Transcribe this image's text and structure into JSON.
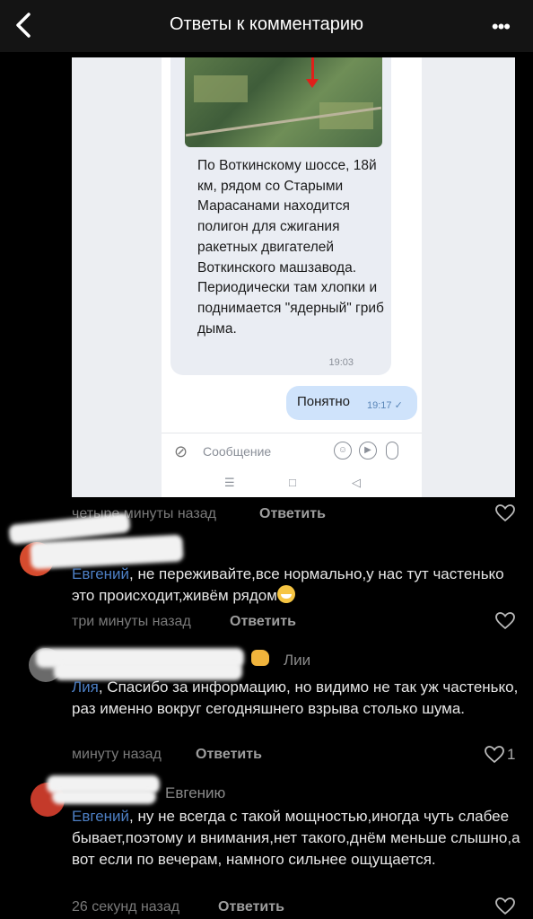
{
  "header": {
    "title": "Ответы к комментарию",
    "back": "back-chevron-icon",
    "more": "•••"
  },
  "screenshot": {
    "message": "По Воткинскому шоссе, 18й км, рядом со Старыми Марасанами находится полигон для сжигания ракетных двигателей Воткинского машзавода. Периодически там хлопки и поднимается \"ядерный\" гриб дыма.",
    "time": "19:03",
    "reply_text": "Понятно",
    "reply_time": "19:17 ✓",
    "compose_placeholder": "Сообщение",
    "nav": [
      "☰",
      "□",
      "◁"
    ]
  },
  "comments": [
    {
      "time": "четыре минуты назад",
      "reply": "Ответить"
    },
    {
      "mention": "Евгений",
      "text": ", не переживайте,все нормально,у нас тут частенько это происходит,живём рядом",
      "time": "три минуты назад",
      "reply": "Ответить"
    },
    {
      "addressee": "Лии",
      "mention": "Лия",
      "text": ", Спасибо за информацию, но видимо не так уж частенько, раз именно вокруг сегодняшнего взрыва столько шума.",
      "time": "минуту назад",
      "reply": "Ответить",
      "likes": "1"
    },
    {
      "addressee": "Евгению",
      "mention": "Евгений",
      "text": ", ну не всегда с такой мощностью,иногда чуть слабее бывает,поэтому и внимания,нет такого,днём меньше слышно,а вот если по вечерам, намного сильнее ощущается.",
      "time": "26 секунд назад",
      "reply": "Ответить"
    }
  ],
  "colors": {
    "background": "#000000",
    "header": "#141414",
    "mention": "#4d7fc4",
    "meta": "#7a7a7a"
  }
}
